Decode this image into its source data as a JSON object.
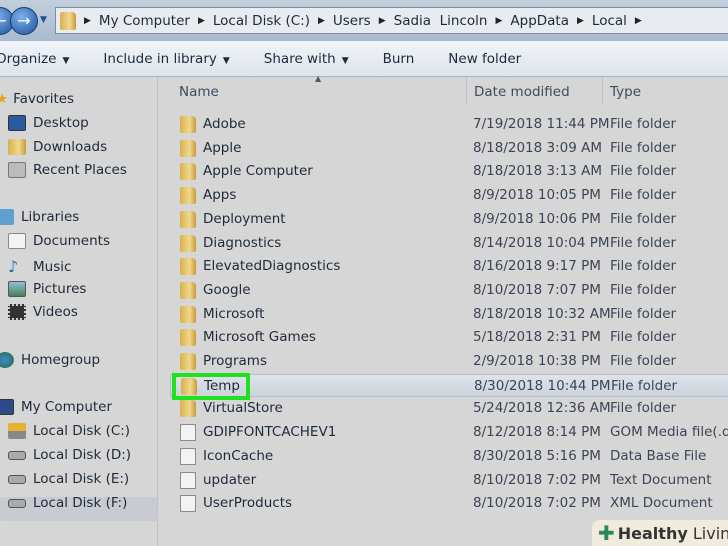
{
  "address": {
    "crumbs": [
      "My Computer",
      "Local Disk (C:)",
      "Users",
      "Sadia  Lincoln",
      "AppData",
      "Local"
    ]
  },
  "toolbar": {
    "organize": "Organize",
    "include": "Include in library",
    "share": "Share with",
    "burn": "Burn",
    "new_folder": "New folder"
  },
  "columns": {
    "name": "Name",
    "date": "Date modified",
    "type": "Type"
  },
  "sidebar": {
    "favorites": "Favorites",
    "desktop": "Desktop",
    "downloads": "Downloads",
    "recent": "Recent Places",
    "libraries": "Libraries",
    "documents": "Documents",
    "music": "Music",
    "pictures": "Pictures",
    "videos": "Videos",
    "homegroup": "Homegroup",
    "computer": "My Computer",
    "disk_c": "Local Disk (C:)",
    "disk_d": "Local Disk (D:)",
    "disk_e": "Local Disk (E:)",
    "disk_f": "Local Disk (F:)"
  },
  "files": [
    {
      "name": "Adobe",
      "date": "7/19/2018 11:44 PM",
      "type": "File folder",
      "icon": "folder"
    },
    {
      "name": "Apple",
      "date": "8/18/2018 3:09 AM",
      "type": "File folder",
      "icon": "folder"
    },
    {
      "name": "Apple Computer",
      "date": "8/18/2018 3:13 AM",
      "type": "File folder",
      "icon": "folder"
    },
    {
      "name": "Apps",
      "date": "8/9/2018 10:05 PM",
      "type": "File folder",
      "icon": "folder"
    },
    {
      "name": "Deployment",
      "date": "8/9/2018 10:06 PM",
      "type": "File folder",
      "icon": "folder"
    },
    {
      "name": "Diagnostics",
      "date": "8/14/2018 10:04 PM",
      "type": "File folder",
      "icon": "folder"
    },
    {
      "name": "ElevatedDiagnostics",
      "date": "8/16/2018 9:17 PM",
      "type": "File folder",
      "icon": "folder"
    },
    {
      "name": "Google",
      "date": "8/10/2018 7:07 PM",
      "type": "File folder",
      "icon": "folder"
    },
    {
      "name": "Microsoft",
      "date": "8/18/2018 10:32 AM",
      "type": "File folder",
      "icon": "folder"
    },
    {
      "name": "Microsoft Games",
      "date": "5/18/2018 2:31 PM",
      "type": "File folder",
      "icon": "folder"
    },
    {
      "name": "Programs",
      "date": "2/9/2018 10:38 PM",
      "type": "File folder",
      "icon": "folder"
    },
    {
      "name": "Temp",
      "date": "8/30/2018 10:44 PM",
      "type": "File folder",
      "icon": "folder"
    },
    {
      "name": "VirtualStore",
      "date": "5/24/2018 12:36 AM",
      "type": "File folder",
      "icon": "folder"
    },
    {
      "name": "GDIPFONTCACHEV1",
      "date": "8/12/2018 8:14 PM",
      "type": "GOM Media file(.d...",
      "icon": "dat-file"
    },
    {
      "name": "IconCache",
      "date": "8/30/2018 5:16 PM",
      "type": "Data Base File",
      "icon": "db-file"
    },
    {
      "name": "updater",
      "date": "8/10/2018 7:02 PM",
      "type": "Text Document",
      "icon": "text-file"
    },
    {
      "name": "UserProducts",
      "date": "8/10/2018 7:02 PM",
      "type": "XML Document",
      "icon": "xml-file"
    }
  ],
  "highlight_color": "#20e020",
  "watermark": {
    "bold": "Healthy",
    "light": "Living"
  }
}
